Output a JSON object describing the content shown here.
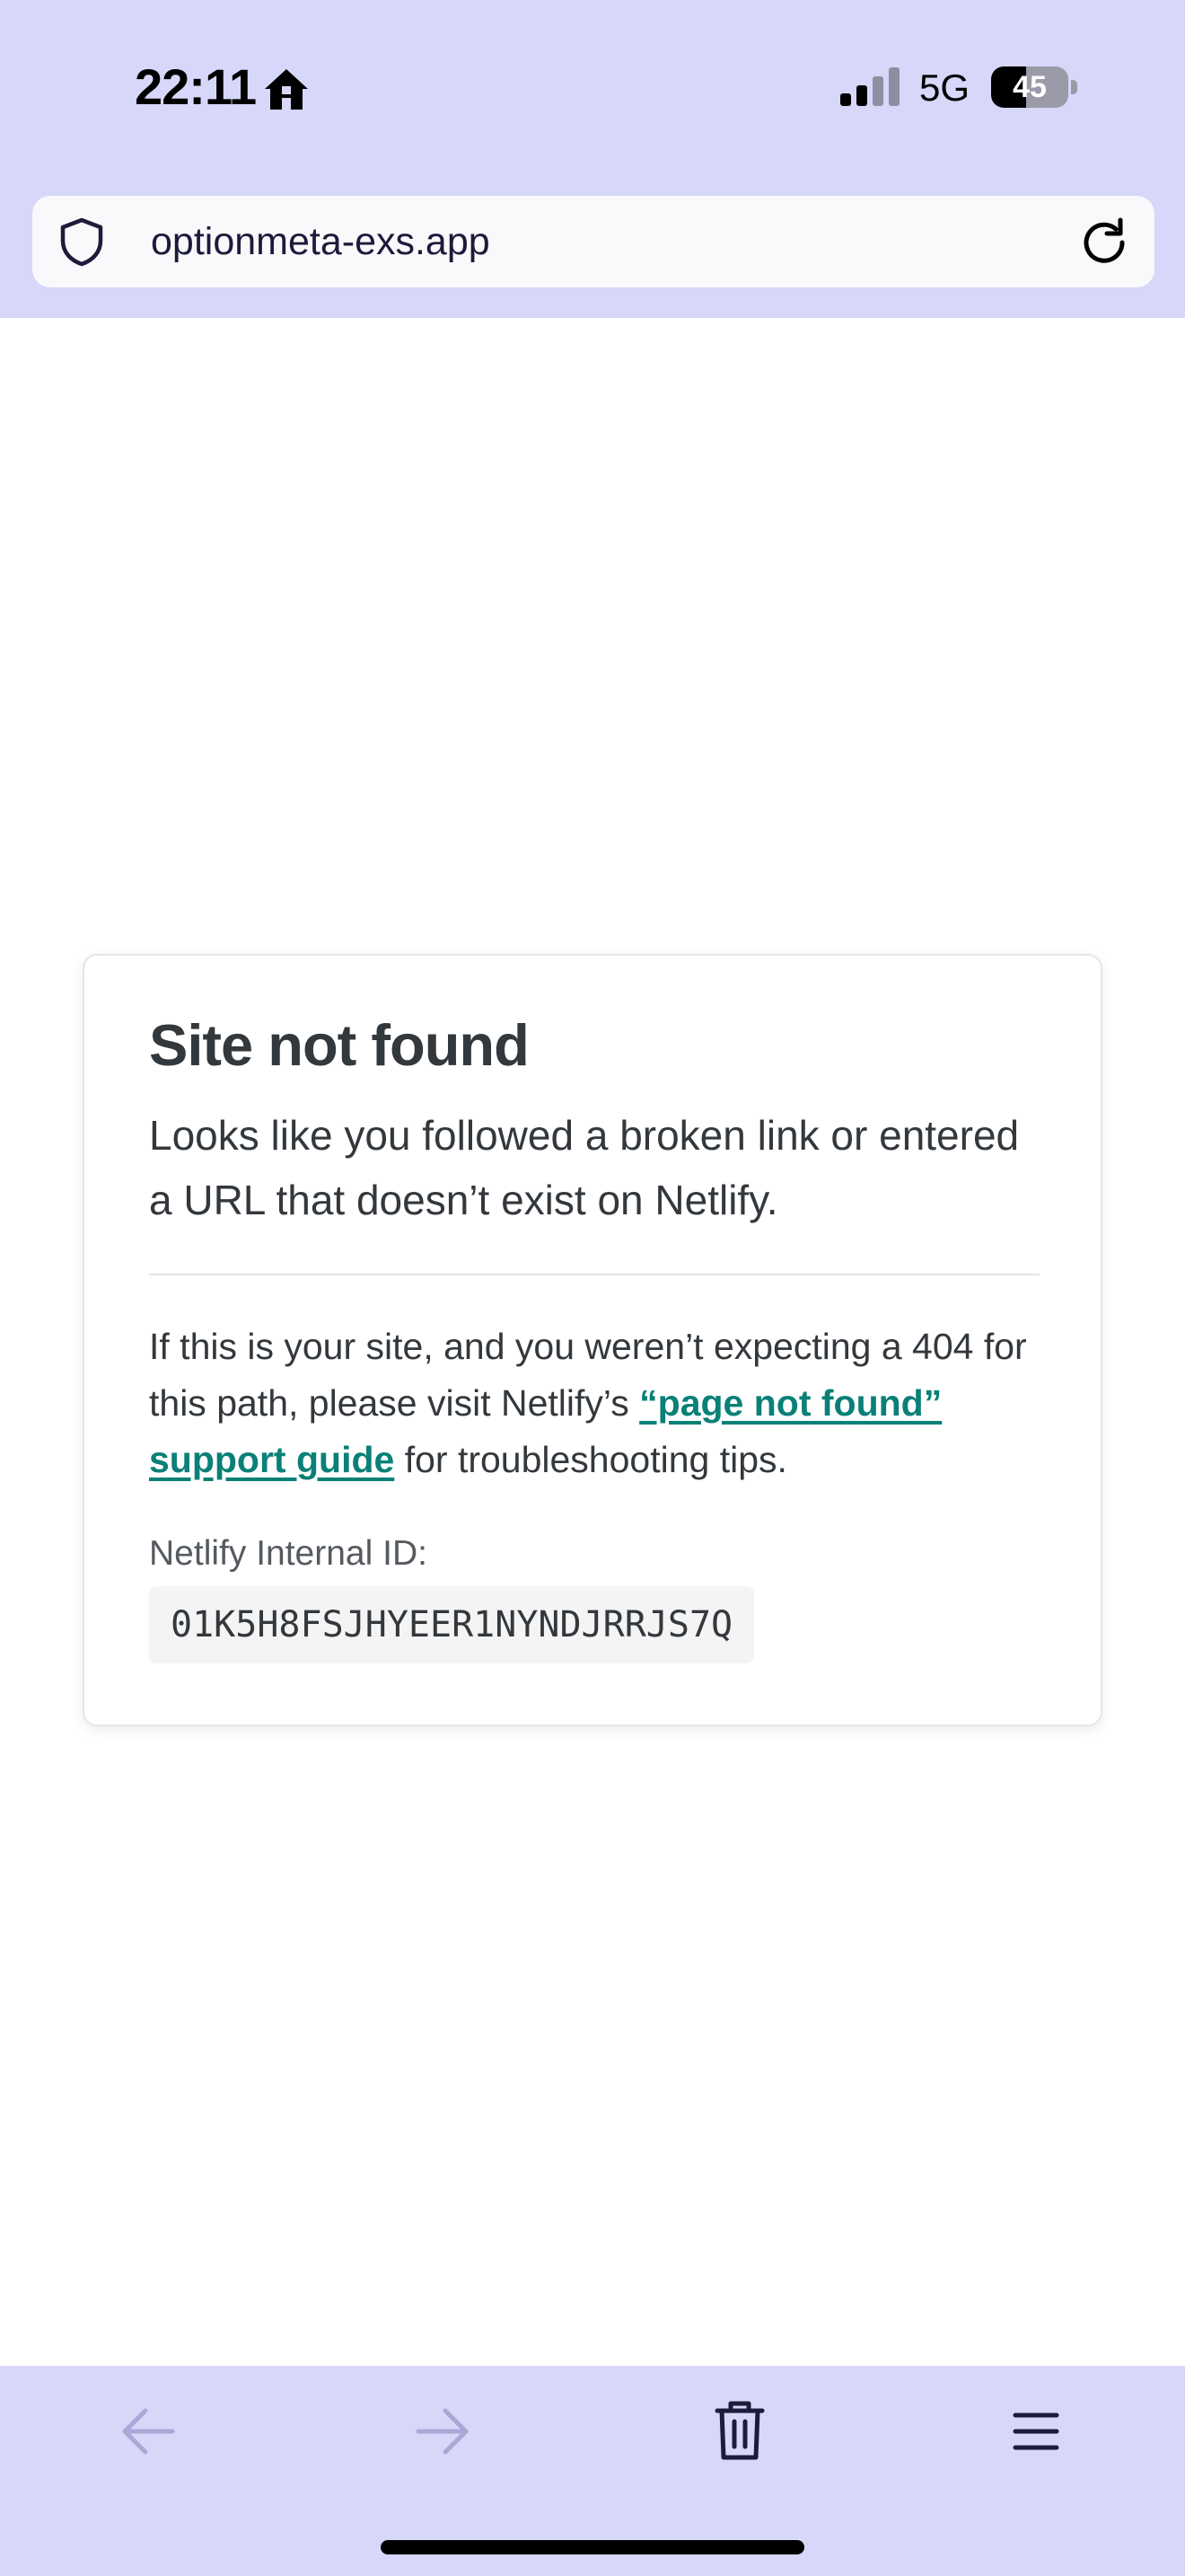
{
  "status_bar": {
    "time": "22:11",
    "network": "5G",
    "battery_percent": "45",
    "battery_level": 0.45,
    "icons": [
      "home-icon",
      "signal-icon",
      "battery-icon"
    ]
  },
  "browser": {
    "url": "optionmeta-exs.app",
    "icons": [
      "shield-icon",
      "reload-icon"
    ]
  },
  "page": {
    "title": "Site not found",
    "lead": "Looks like you followed a broken link or entered a URL that doesn’t exist on Netlify.",
    "help_before": "If this is your site, and you weren’t expecting a 404 for this path, please visit Netlify’s ",
    "help_link": "“page not found” support guide",
    "help_after": " for troubleshooting tips.",
    "id_label": "Netlify Internal ID:",
    "id_value": "01K5H8FSJHYEER1NYNDJRRJS7Q"
  },
  "toolbar": {
    "icons": [
      "back-arrow-icon",
      "forward-arrow-icon",
      "trash-icon",
      "menu-icon"
    ]
  },
  "colors": {
    "chrome_background": "#d7d7f9",
    "link": "#0a8077",
    "text": "#33383d",
    "icon_dark": "#1c1b3a",
    "icon_disabled": "#a9a8d6"
  }
}
